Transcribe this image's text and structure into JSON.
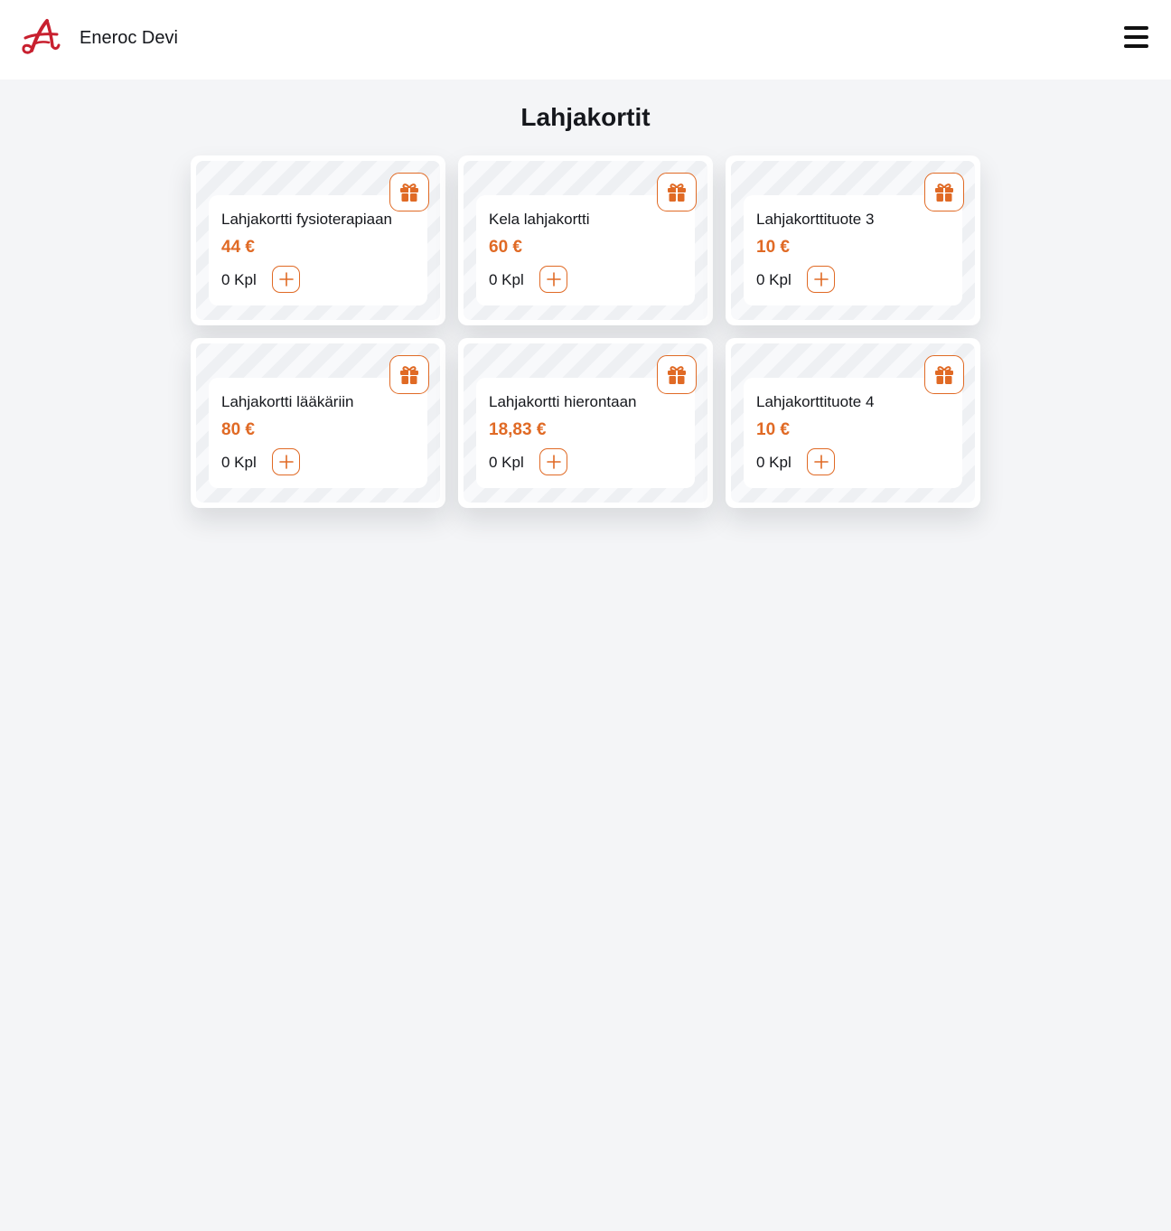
{
  "header": {
    "brand_name": "Eneroc Devi",
    "logo_icon": "eneroc-logo-icon",
    "menu_icon": "hamburger-menu-icon"
  },
  "page": {
    "title": "Lahjakortit"
  },
  "colors": {
    "accent": "#e06a25",
    "logo_red": "#c8202f",
    "background": "#f4f5f7",
    "text": "#15171c"
  },
  "products": [
    {
      "name": "Lahjakortti fysioterapiaan",
      "price": "44 €",
      "quantity": "0 Kpl",
      "icon": "gift-icon",
      "add_icon": "plus-icon"
    },
    {
      "name": "Kela lahjakortti",
      "price": "60 €",
      "quantity": "0 Kpl",
      "icon": "gift-icon",
      "add_icon": "plus-icon"
    },
    {
      "name": "Lahjakorttituote 3",
      "price": "10 €",
      "quantity": "0 Kpl",
      "icon": "gift-icon",
      "add_icon": "plus-icon"
    },
    {
      "name": "Lahjakortti lääkäriin",
      "price": "80 €",
      "quantity": "0 Kpl",
      "icon": "gift-icon",
      "add_icon": "plus-icon"
    },
    {
      "name": "Lahjakortti hierontaan",
      "price": "18,83 €",
      "quantity": "0 Kpl",
      "icon": "gift-icon",
      "add_icon": "plus-icon"
    },
    {
      "name": "Lahjakorttituote 4",
      "price": "10 €",
      "quantity": "0 Kpl",
      "icon": "gift-icon",
      "add_icon": "plus-icon"
    }
  ]
}
